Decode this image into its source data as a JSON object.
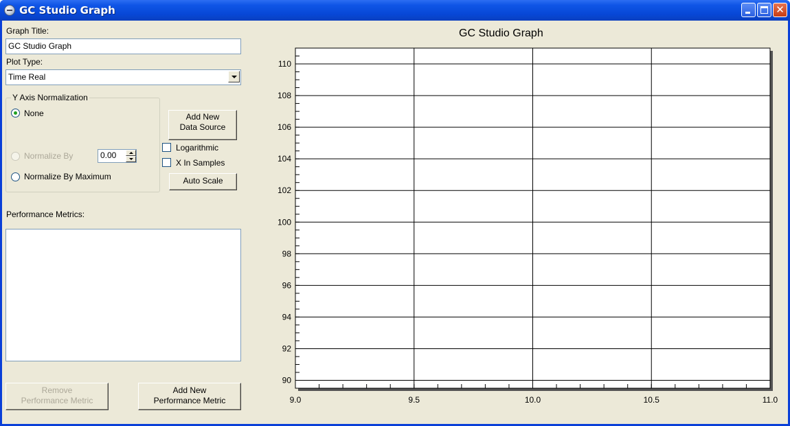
{
  "window": {
    "title": "GC Studio Graph"
  },
  "form": {
    "graph_title_label": "Graph Title:",
    "graph_title_value": "GC Studio Graph",
    "plot_type_label": "Plot Type:",
    "plot_type_value": "Time Real",
    "y_axis_group_label": "Y Axis Normalization",
    "radio_none": "None",
    "radio_normalize_by": "Normalize By",
    "normalize_by_value": "0.00",
    "radio_normalize_max": "Normalize By Maximum",
    "add_data_source_line1": "Add New",
    "add_data_source_line2": "Data Source",
    "logarithmic_label": "Logarithmic",
    "x_in_samples_label": "X In Samples",
    "auto_scale_label": "Auto Scale",
    "performance_metrics_label": "Performance Metrics:",
    "remove_metric_line1": "Remove",
    "remove_metric_line2": "Performance Metric",
    "add_metric_line1": "Add New",
    "add_metric_line2": "Performance Metric",
    "selected_radio": "None",
    "logarithmic_checked": false,
    "x_in_samples_checked": false
  },
  "chart_data": {
    "type": "line",
    "title": "GC Studio Graph",
    "xlabel": "",
    "ylabel": "",
    "xlim": [
      9.0,
      11.0
    ],
    "ylim": [
      89.5,
      111
    ],
    "x_ticks": [
      "9.0",
      "9.5",
      "10.0",
      "10.5",
      "11.0"
    ],
    "y_ticks": [
      "90",
      "92",
      "94",
      "96",
      "98",
      "100",
      "102",
      "104",
      "106",
      "108",
      "110"
    ],
    "grid": true,
    "series": []
  }
}
